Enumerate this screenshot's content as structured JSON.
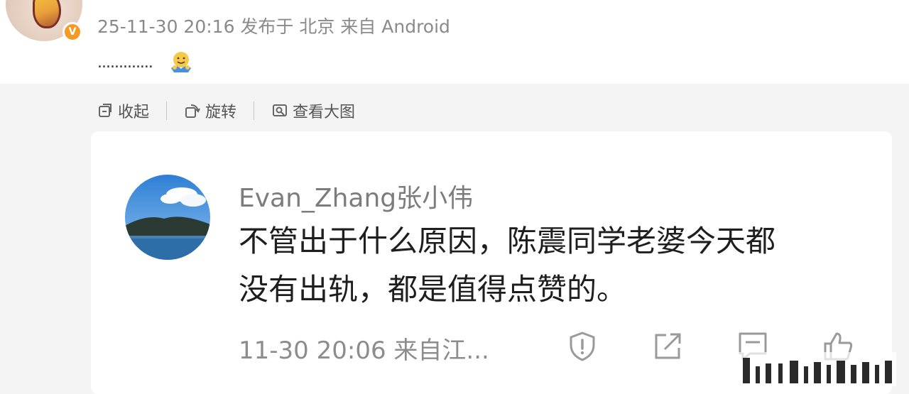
{
  "post": {
    "meta": "25-11-30 20:16 发布于 北京 来自 Android",
    "text": "............."
  },
  "toolbar": {
    "collapse_label": "收起",
    "rotate_label": "旋转",
    "view_large_label": "查看大图"
  },
  "comment": {
    "username": "Evan_Zhang张小伟",
    "body_line1": "不管出于什么原因，陈震同学老婆今天都",
    "body_line2": "没有出轨，都是值得点赞的。",
    "meta": "11-30 20:06 来自江..."
  },
  "icons": {
    "avatar_badge": "verified-v-icon",
    "emoji": "hug-emoji-icon",
    "report": "shield-exclamation-icon",
    "share": "external-link-icon",
    "reply": "comment-icon",
    "like": "thumbs-up-icon"
  },
  "colors": {
    "badge_orange": "#f59a23",
    "meta_gray": "#8a8a8a",
    "panel_gray": "#f4f4f4"
  }
}
